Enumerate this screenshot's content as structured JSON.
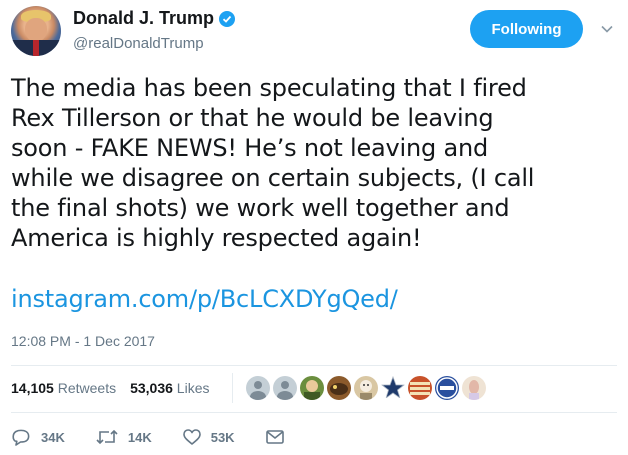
{
  "user": {
    "name": "Donald J. Trump",
    "handle": "@realDonaldTrump",
    "follow_label": "Following"
  },
  "tweet": {
    "text": "The media has been speculating that I fired\nRex Tillerson or that he would be leaving\nsoon - FAKE NEWS! He’s not leaving and\nwhile we disagree on certain subjects, (I call\nthe final shots) we work well together and\nAmerica is highly respected again!",
    "link": "instagram.com/p/BcLCXDYgQed/",
    "timestamp": "12:08 PM - 1 Dec 2017"
  },
  "stats": {
    "retweets_count": "14,105",
    "retweets_label": "Retweets",
    "likes_count": "53,036",
    "likes_label": "Likes",
    "likers": [
      {
        "kind": "default-avatar"
      },
      {
        "kind": "default-avatar"
      },
      {
        "kind": "green-avatar",
        "color": "#6b8e3e"
      },
      {
        "kind": "bird-avatar",
        "color": "#8b5a2b"
      },
      {
        "kind": "face-avatar",
        "color": "#d9c7a3"
      },
      {
        "kind": "star-avatar",
        "color": "#1f3a6b"
      },
      {
        "kind": "sign-avatar",
        "color": "#c8522a"
      },
      {
        "kind": "badge-avatar",
        "color": "#2a4f9e"
      },
      {
        "kind": "portrait-avatar",
        "color": "#efe3d4"
      }
    ]
  },
  "actions": {
    "reply_count": "34K",
    "retweet_count": "14K",
    "like_count": "53K"
  },
  "colors": {
    "accent": "#1da1f2",
    "link": "#1b95e0",
    "muted": "#657786"
  }
}
